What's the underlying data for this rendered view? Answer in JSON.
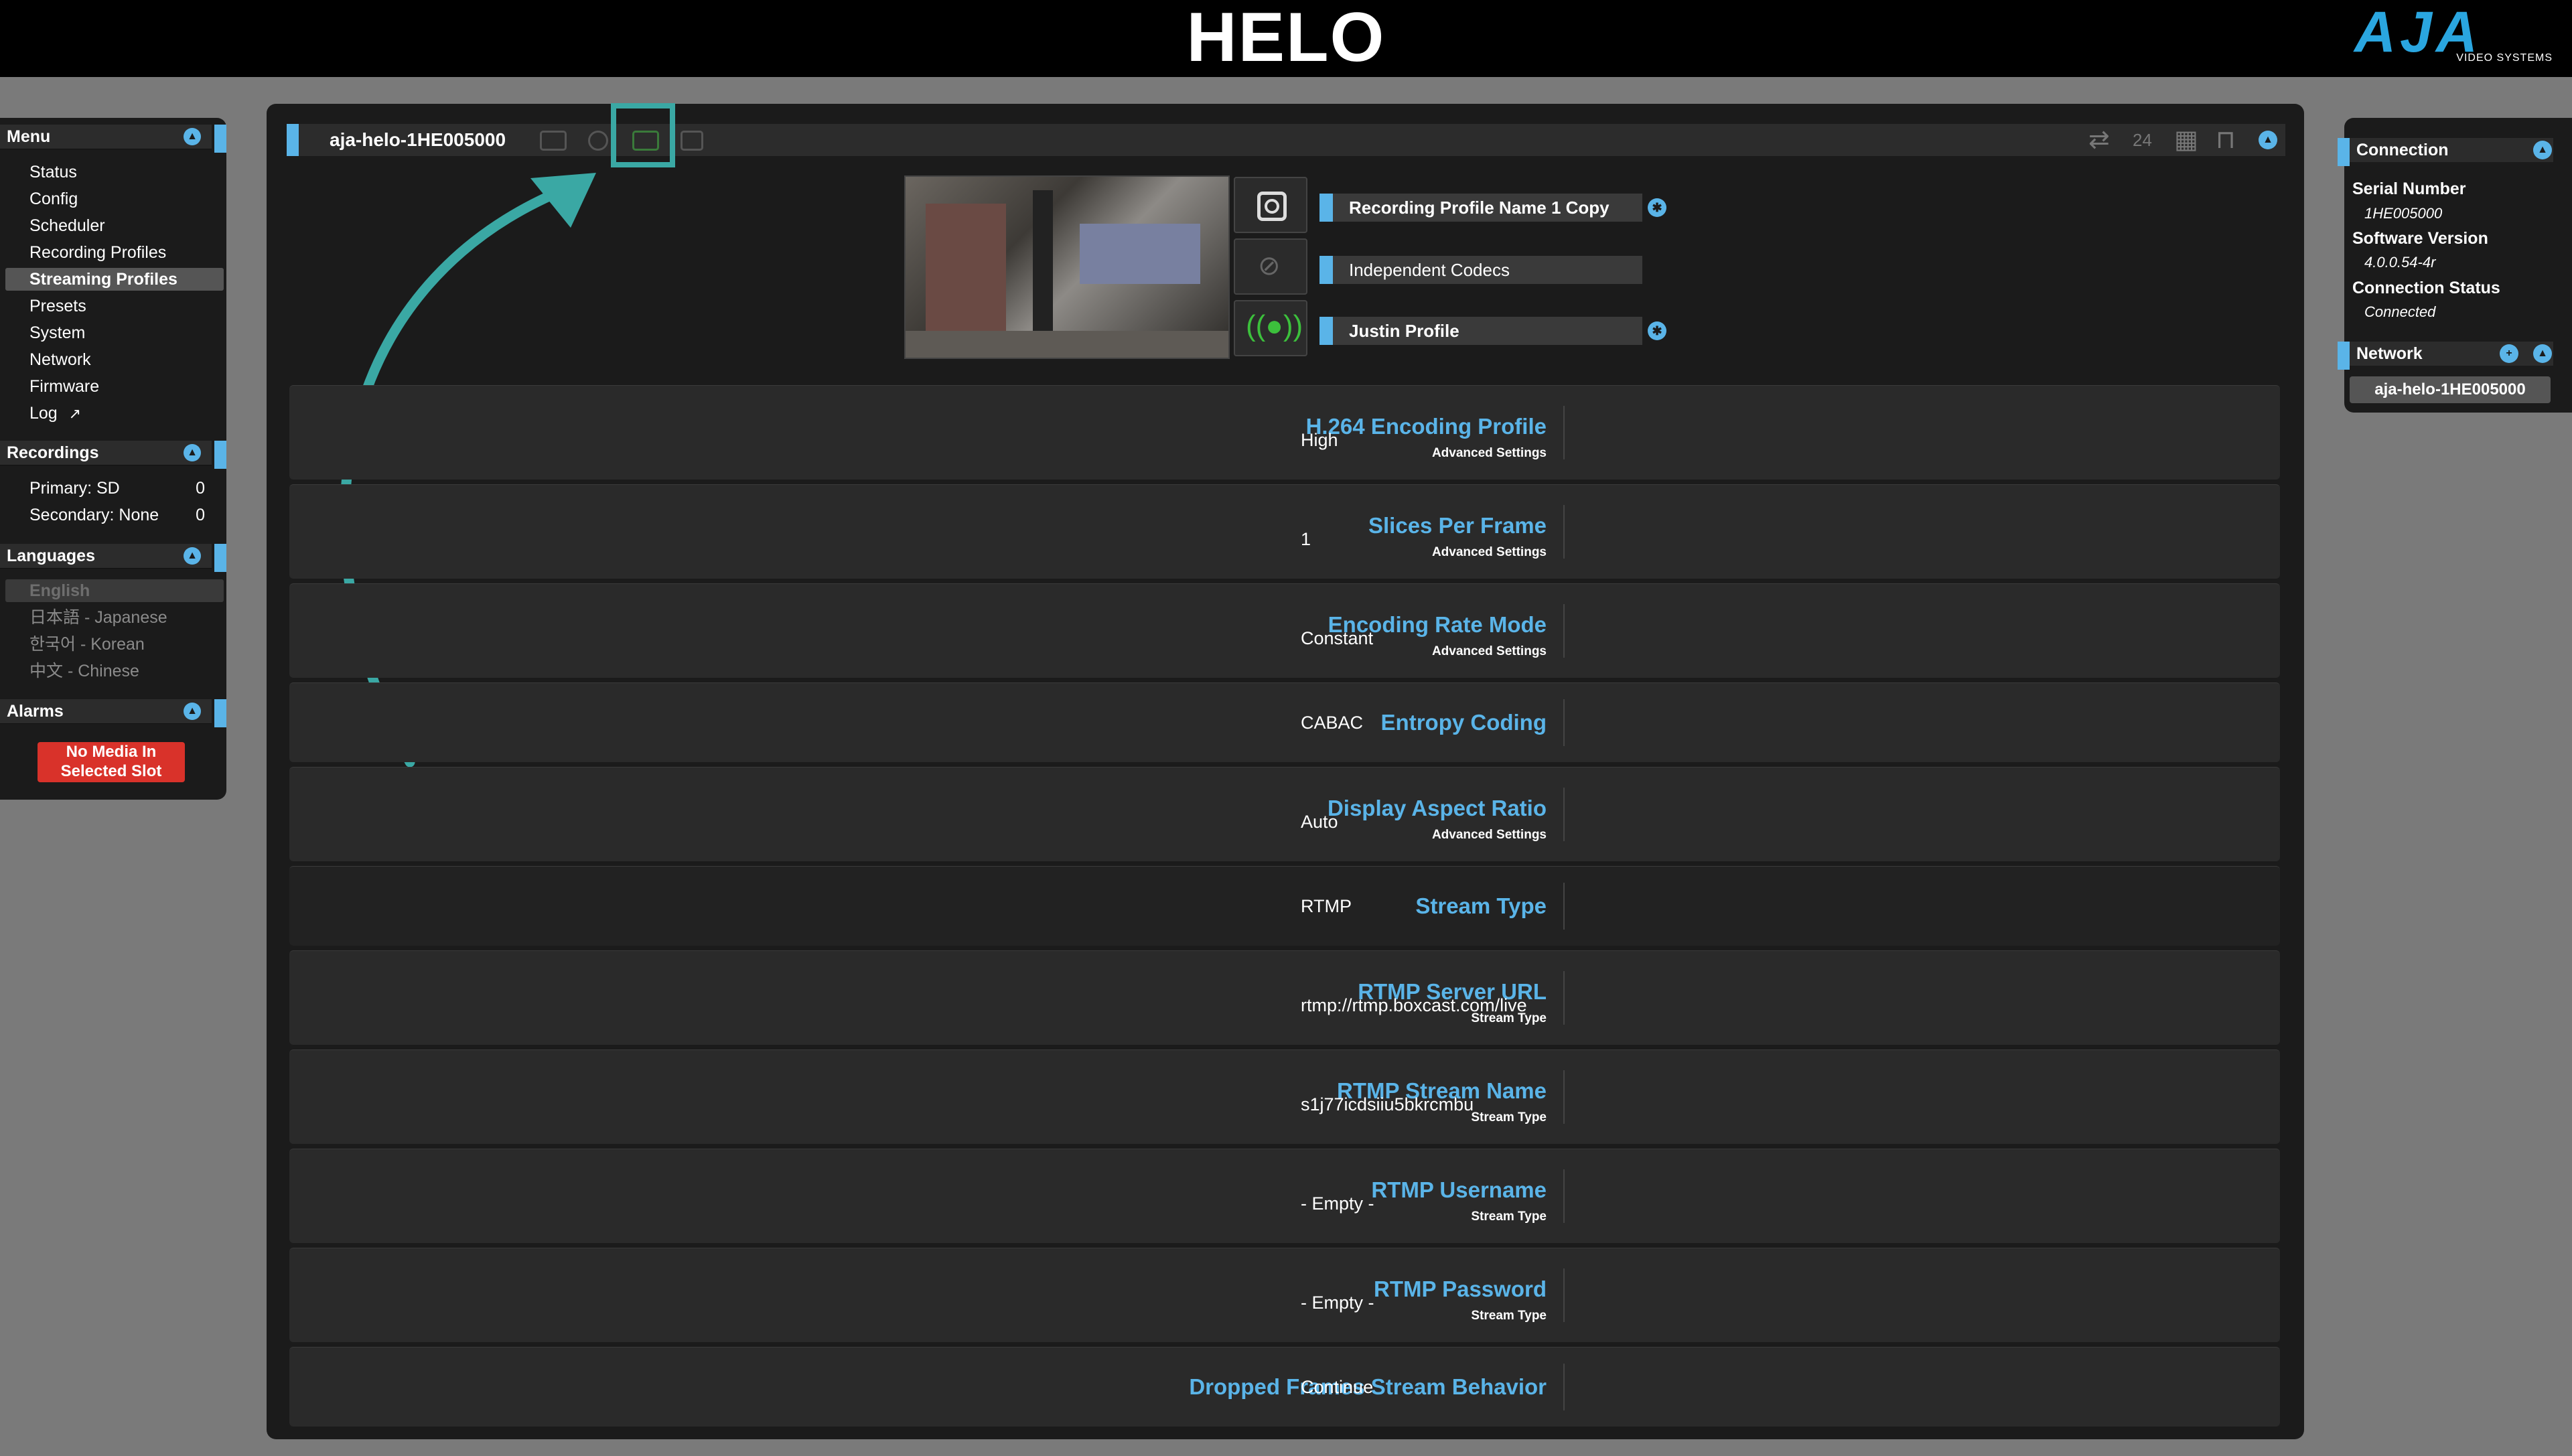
{
  "app": {
    "title": "HELO",
    "brand": "AJA",
    "brand_sub": "VIDEO SYSTEMS"
  },
  "sidebar": {
    "menu_title": "Menu",
    "menu_items": [
      "Status",
      "Config",
      "Scheduler",
      "Recording Profiles",
      "Streaming Profiles",
      "Presets",
      "System",
      "Network",
      "Firmware",
      "Log"
    ],
    "active_item": "Streaming Profiles",
    "recordings_title": "Recordings",
    "recordings": [
      {
        "label": "Primary: SD",
        "count": "0"
      },
      {
        "label": "Secondary: None",
        "count": "0"
      }
    ],
    "languages_title": "Languages",
    "languages": [
      "English",
      "日本語 - Japanese",
      "한국어 - Korean",
      "中文 - Chinese"
    ],
    "alarms_title": "Alarms",
    "alarm_text": "No Media In Selected Slot"
  },
  "device": {
    "name": "aja-helo-1HE005000",
    "right_icon_calendar": "24"
  },
  "profiles": {
    "recording": "Recording Profile Name 1 Copy",
    "codecs": "Independent Codecs",
    "streaming": "Justin Profile"
  },
  "settings": [
    {
      "label": "H.264 Encoding Profile",
      "sub": "Advanced Settings",
      "value": "High"
    },
    {
      "label": "Slices Per Frame",
      "sub": "Advanced Settings",
      "value": "1"
    },
    {
      "label": "Encoding Rate Mode",
      "sub": "Advanced Settings",
      "value": "Constant"
    },
    {
      "label": "Entropy Coding",
      "sub": "",
      "value": "CABAC"
    },
    {
      "label": "Display Aspect Ratio",
      "sub": "Advanced Settings",
      "value": "Auto"
    },
    {
      "label": "Stream Type",
      "sub": "",
      "value": "RTMP"
    },
    {
      "label": "RTMP Server URL",
      "sub": "Stream Type",
      "value": "rtmp://rtmp.boxcast.com/live"
    },
    {
      "label": "RTMP Stream Name",
      "sub": "Stream Type",
      "value": "s1j77icdsiiu5bkrcmbu"
    },
    {
      "label": "RTMP Username",
      "sub": "Stream Type",
      "value": "- Empty -"
    },
    {
      "label": "RTMP Password",
      "sub": "Stream Type",
      "value": "- Empty -"
    },
    {
      "label": "Dropped Frames Stream Behavior",
      "sub": "",
      "value": "Continue"
    }
  ],
  "right_panel": {
    "connection_title": "Connection",
    "serial_label": "Serial Number",
    "serial_value": "1HE005000",
    "software_label": "Software Version",
    "software_value": "4.0.0.54-4r",
    "status_label": "Connection Status",
    "status_value": "Connected",
    "network_title": "Network",
    "network_device": "aja-helo-1HE005000"
  },
  "colors": {
    "accent": "#5ab4e8",
    "annotation": "#3aa8a4",
    "alarm": "#d9322a"
  }
}
